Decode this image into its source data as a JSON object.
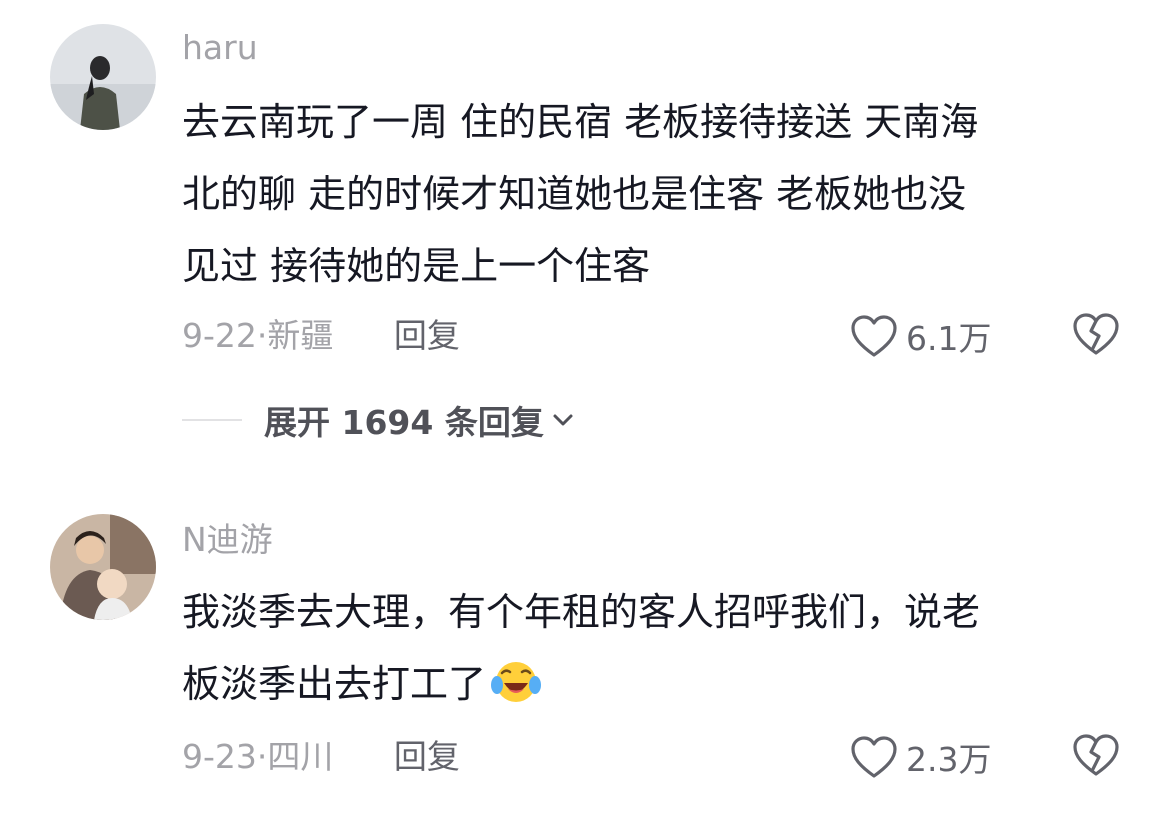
{
  "comments": [
    {
      "username": "haru",
      "lines": [
        "去云南玩了一周 住的民宿 老板接待接送 天南海",
        "北的聊 走的时候才知道她也是住客 老板她也没",
        "见过 接待她的是上一个住客"
      ],
      "date": "9-22",
      "separator": "·",
      "location": "新疆",
      "reply_label": "回复",
      "likes": "6.1万"
    },
    {
      "username": "N迪游",
      "lines": [
        "我淡季去大理，有个年租的客人招呼我们，说老",
        "板淡季出去打工了"
      ],
      "date": "9-23",
      "separator": "·",
      "location": "四川",
      "reply_label": "回复",
      "likes": "2.3万"
    }
  ],
  "expand_replies": {
    "label": "展开 1694 条回复"
  },
  "icons": {
    "like": "heart-outline-icon",
    "dislike": "broken-heart-icon",
    "expand": "chevron-down-icon",
    "emoji": "laughing-tears-emoji"
  },
  "colors": {
    "text_primary": "#161823",
    "text_secondary": "#a3a3a8",
    "action": "#62636b"
  }
}
